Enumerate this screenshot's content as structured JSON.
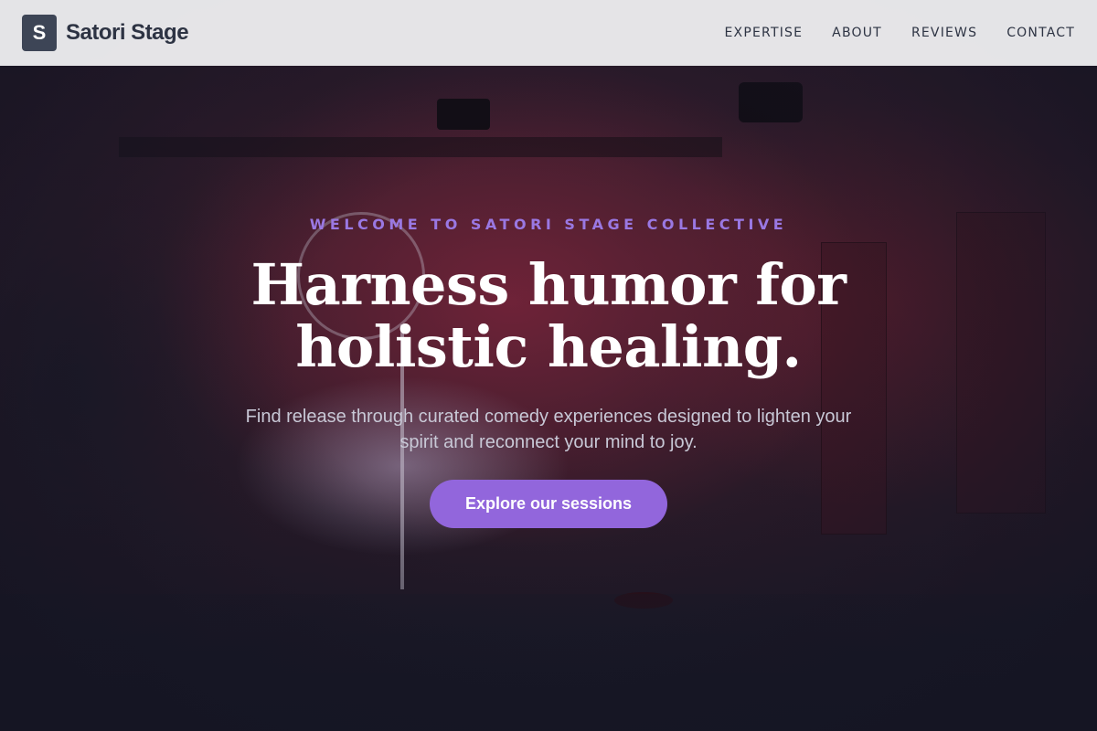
{
  "header": {
    "logo_letter": "S",
    "brand_name": "Satori Stage",
    "nav": [
      {
        "label": "EXPERTISE"
      },
      {
        "label": "ABOUT"
      },
      {
        "label": "REVIEWS"
      },
      {
        "label": "CONTACT"
      }
    ]
  },
  "hero": {
    "eyebrow": "WELCOME TO SATORI STAGE COLLECTIVE",
    "headline": "Harness humor for holistic healing.",
    "subtitle": "Find release through curated comedy experiences designed to lighten your spirit and reconnect your mind to joy.",
    "cta_label": "Explore our sessions"
  },
  "colors": {
    "accent": "#9266dc",
    "eyebrow": "#9a78e3",
    "header_bg": "#ebebed",
    "brand_mark": "#3d4556",
    "nav_text": "#2d3343"
  }
}
